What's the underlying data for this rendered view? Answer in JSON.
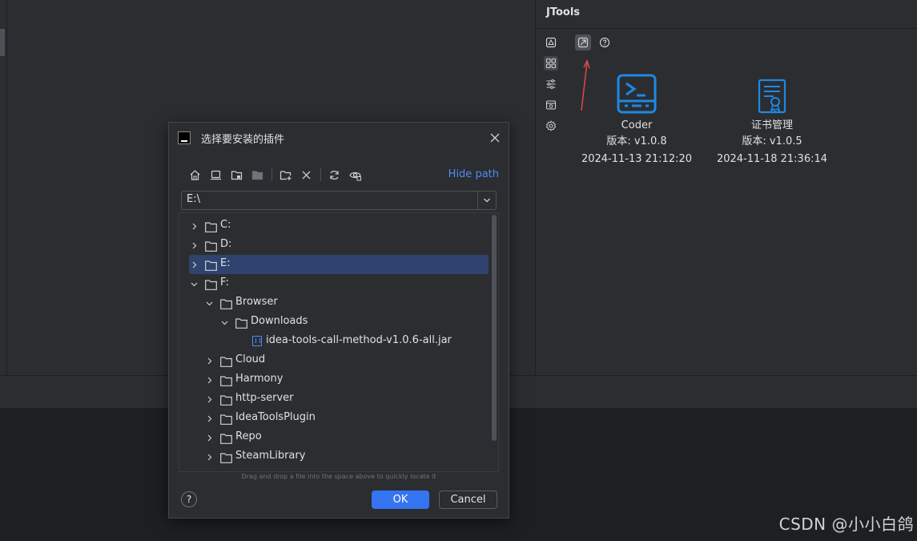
{
  "panel": {
    "title": "JTools",
    "side_icons": [
      "plugin-market-icon",
      "plugins-grid-icon",
      "settings-sliders-icon",
      "browser-window-icon",
      "gear-icon"
    ],
    "toolbar_icons": [
      "install-from-disk-icon",
      "help-icon"
    ]
  },
  "plugins": [
    {
      "name": "Coder",
      "version": "版本: v1.0.8",
      "date": "2024-11-13 21:12:20",
      "icon": "terminal-icon"
    },
    {
      "name": "证书管理",
      "version": "版本: v1.0.5",
      "date": "2024-11-18 21:36:14",
      "icon": "certificate-icon"
    }
  ],
  "dialog": {
    "title": "选择要安装的插件",
    "hide_path": "Hide path",
    "path": "E:\\",
    "hint": "Drag and drop a file into the space above to quickly locate it",
    "ok": "OK",
    "cancel": "Cancel",
    "help": "?",
    "toolbar": [
      "home-icon",
      "desktop-icon",
      "project-folder-icon",
      "module-folder-icon",
      "new-folder-icon",
      "delete-icon",
      "refresh-icon",
      "show-hidden-icon"
    ],
    "tree": [
      {
        "label": "C:",
        "level": 0,
        "expanded": false,
        "type": "folder"
      },
      {
        "label": "D:",
        "level": 0,
        "expanded": false,
        "type": "folder"
      },
      {
        "label": "E:",
        "level": 0,
        "expanded": false,
        "type": "folder",
        "selected": true
      },
      {
        "label": "F:",
        "level": 0,
        "expanded": true,
        "type": "folder"
      },
      {
        "label": "Browser",
        "level": 1,
        "expanded": true,
        "type": "folder"
      },
      {
        "label": "Downloads",
        "level": 2,
        "expanded": true,
        "type": "folder"
      },
      {
        "label": "idea-tools-call-method-v1.0.6-all.jar",
        "level": 3,
        "type": "jar"
      },
      {
        "label": "Cloud",
        "level": 1,
        "expanded": false,
        "type": "folder"
      },
      {
        "label": "Harmony",
        "level": 1,
        "expanded": false,
        "type": "folder"
      },
      {
        "label": "http-server",
        "level": 1,
        "expanded": false,
        "type": "folder"
      },
      {
        "label": "IdeaToolsPlugin",
        "level": 1,
        "expanded": false,
        "type": "folder"
      },
      {
        "label": "Repo",
        "level": 1,
        "expanded": false,
        "type": "folder"
      },
      {
        "label": "SteamLibrary",
        "level": 1,
        "expanded": false,
        "type": "folder"
      }
    ]
  },
  "watermark": "CSDN @小小白鸽",
  "colors": {
    "accent": "#3574f0",
    "link": "#548af7",
    "selection": "#2e436e",
    "plugin_icon": "#1e88e5",
    "arrow": "#e0474c"
  }
}
